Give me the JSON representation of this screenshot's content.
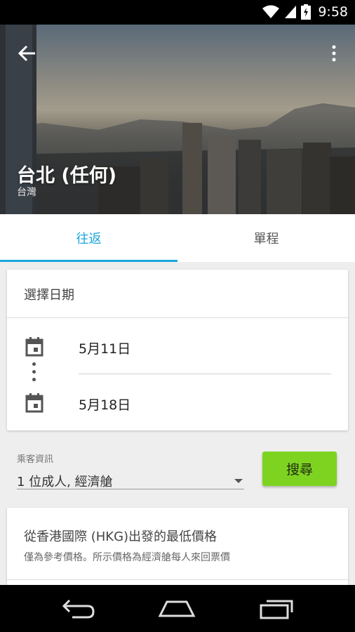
{
  "status_bar": {
    "time": "9:58",
    "icons": [
      "wifi-icon",
      "signal-icon",
      "battery-charging-icon"
    ]
  },
  "header": {
    "back_icon": "arrow-left-icon",
    "more_icon": "more-vertical-icon",
    "title": "台北 (任何)",
    "subtitle": "台灣"
  },
  "tabs": [
    {
      "label": "往返",
      "active": true
    },
    {
      "label": "單程",
      "active": false
    }
  ],
  "date_card": {
    "title": "選擇日期",
    "depart_date": "5月11日",
    "return_date": "5月18日",
    "icon": "calendar-icon"
  },
  "passengers": {
    "label": "乘客資訊",
    "value": "1 位成人, 經濟艙"
  },
  "search_button": {
    "label": "搜尋",
    "color": "#7ed321"
  },
  "price_card": {
    "title": "從香港國際 (HKG)出發的最低價格",
    "subtitle": "僅為參考價格。所示價格為經濟艙每人來回票價"
  },
  "colors": {
    "accent": "#1ba6db",
    "search": "#7ed321"
  },
  "nav_bar": {
    "icons": [
      "back-nav-icon",
      "home-nav-icon",
      "recents-nav-icon"
    ]
  }
}
